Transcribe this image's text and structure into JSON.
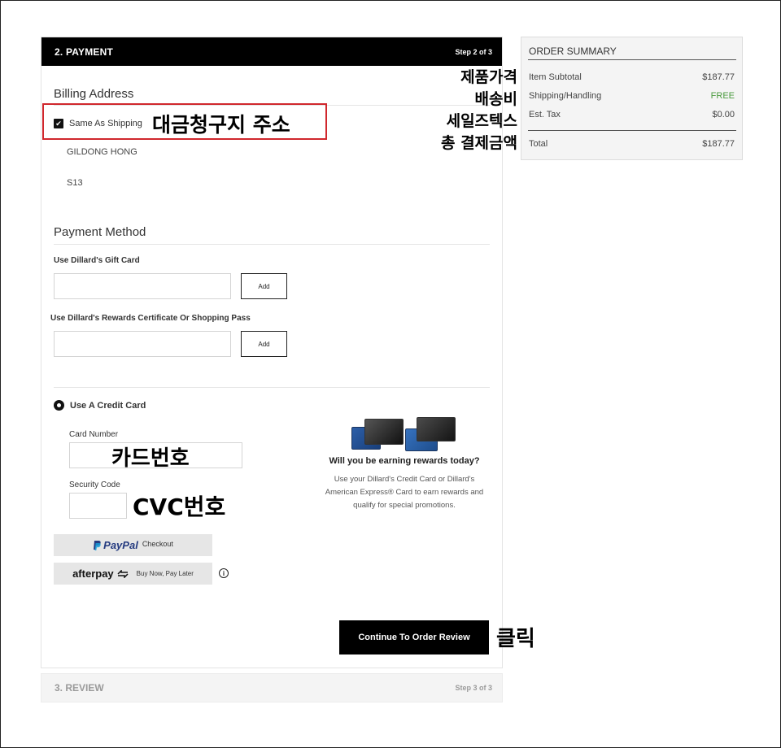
{
  "payment": {
    "title": "2. PAYMENT",
    "step": "Step 2 of 3",
    "billing_title": "Billing Address",
    "same_as_shipping": "Same As Shipping",
    "address_name": "GILDONG HONG",
    "address_line": "S13",
    "payment_method_title": "Payment Method",
    "gift_card_label": "Use Dillard's Gift Card",
    "gift_card_add": "Add",
    "rewards_label": "Use Dillard's Rewards Certificate Or Shopping Pass",
    "rewards_add": "Add",
    "credit_card_option": "Use A Credit Card",
    "card_number_label": "Card Number",
    "security_code_label": "Security Code",
    "paypal_brand": "PayPal",
    "paypal_text": "Checkout",
    "afterpay_brand": "afterpay",
    "afterpay_text": "Buy Now, Pay Later",
    "info_glyph": "i",
    "rewards_promo_title": "Will you be earning rewards today?",
    "rewards_promo_text": "Use your Dillard's Credit Card or Dillard's American Express® Card to earn rewards and qualify for special promotions.",
    "continue_button": "Continue To Order Review"
  },
  "review": {
    "title": "3. REVIEW",
    "step": "Step 3 of 3"
  },
  "order_summary": {
    "title": "ORDER SUMMARY",
    "rows": [
      {
        "label": "Item Subtotal",
        "value": "$187.77"
      },
      {
        "label": "Shipping/Handling",
        "value": "FREE"
      },
      {
        "label": "Est. Tax",
        "value": "$0.00"
      }
    ],
    "total_label": "Total",
    "total_value": "$187.77",
    "free_color": "#4a9a3e"
  },
  "annotations": {
    "billing_address": "대금청구지 주소",
    "card_number": "카드번호",
    "cvc_number": "CVC번호",
    "click": "클릭",
    "summary_labels": [
      "제품가격",
      "배송비",
      "세일즈텍스",
      "총 결제금액"
    ],
    "highlight_color": "#d0272d"
  }
}
